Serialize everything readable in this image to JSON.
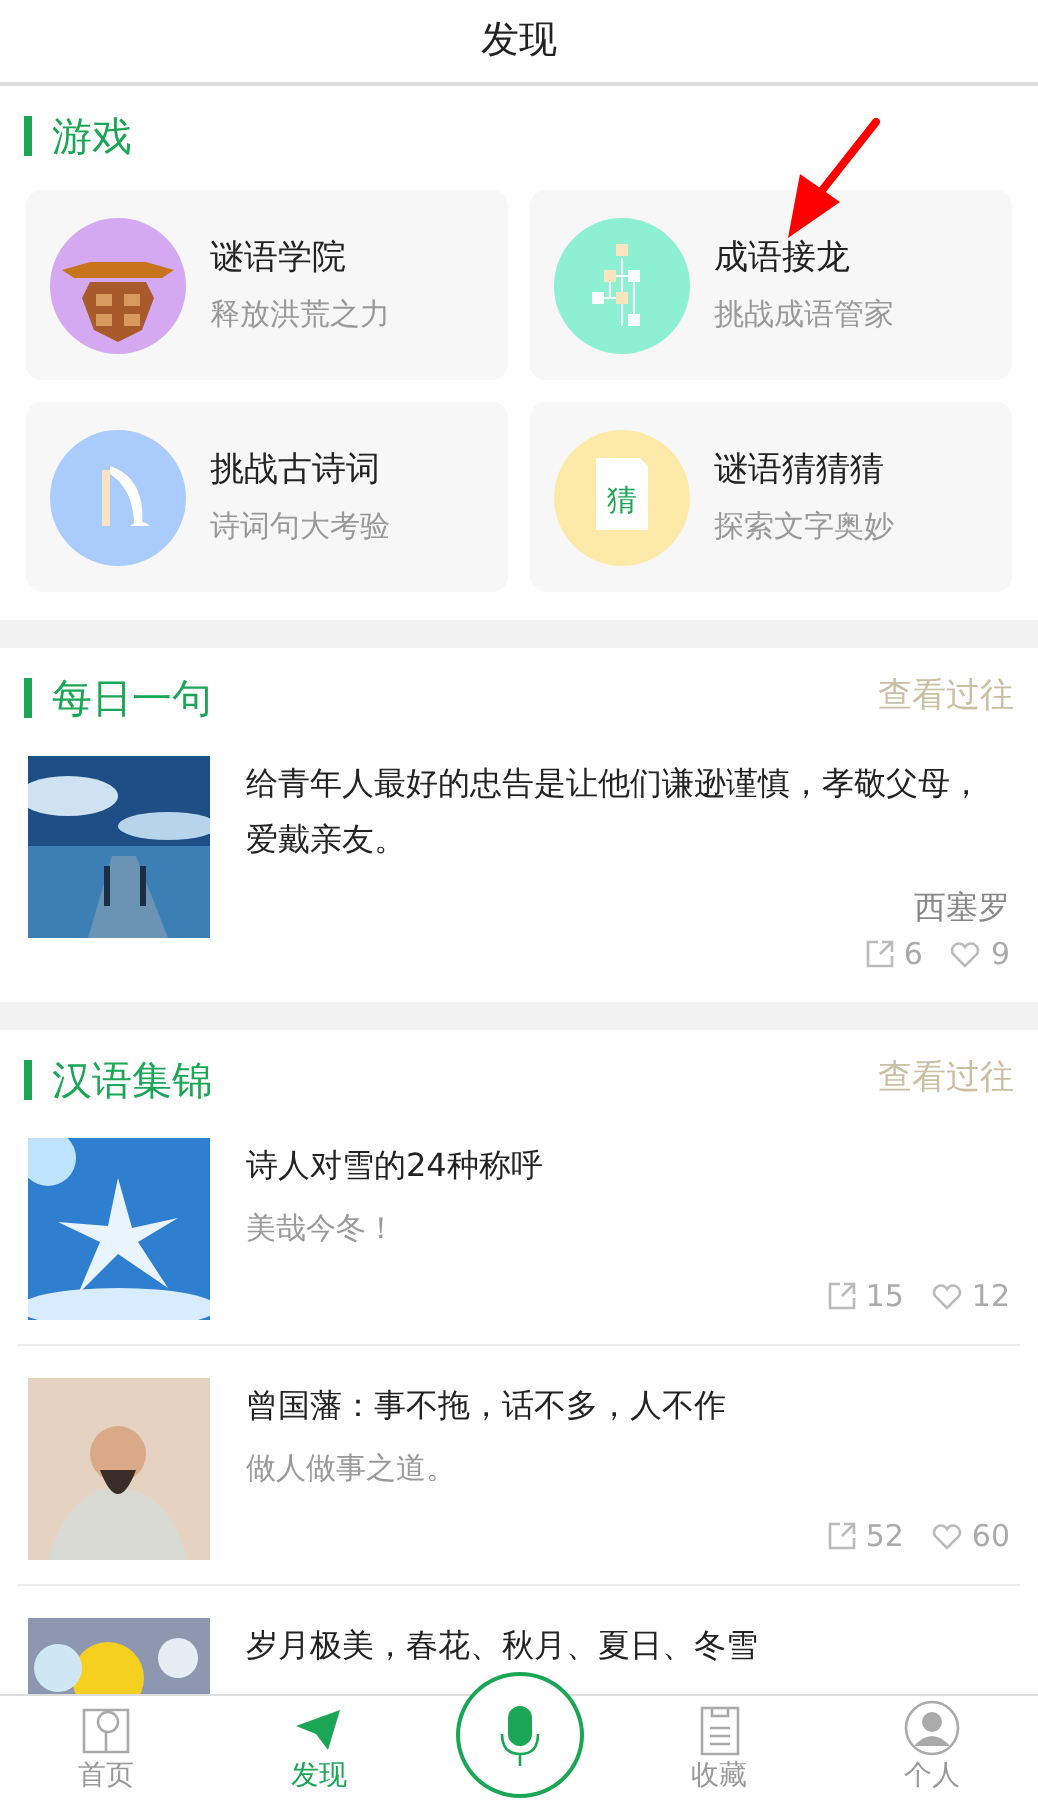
{
  "header": {
    "title": "发现"
  },
  "games": {
    "title": "游戏",
    "items": [
      {
        "kind": "shield",
        "color": "#d4a9f2",
        "title": "谜语学院",
        "subtitle": "释放洪荒之力"
      },
      {
        "kind": "tree",
        "color": "#8ef0d2",
        "title": "成语接龙",
        "subtitle": "挑战成语管家"
      },
      {
        "kind": "quill",
        "color": "#a9ccfc",
        "title": "挑战古诗词",
        "subtitle": "诗词句大考验"
      },
      {
        "kind": "page",
        "color": "#fde9a8",
        "title": "谜语猜猜猜",
        "subtitle": "探索文字奥妙",
        "glyph": "猜"
      }
    ]
  },
  "daily": {
    "title": "每日一句",
    "more": "查看过往",
    "quote": "给青年人最好的忠告是让他们谦逊谨慎，孝敬父母，爱戴亲友。",
    "author": "西塞罗",
    "shares": "6",
    "likes": "9"
  },
  "collection": {
    "title": "汉语集锦",
    "more": "查看过往",
    "items": [
      {
        "title": "诗人对雪的24种称呼",
        "subtitle": "美哉今冬！",
        "shares": "15",
        "likes": "12"
      },
      {
        "title": "曾国藩：事不拖，话不多，人不作",
        "subtitle": "做人做事之道。",
        "shares": "52",
        "likes": "60"
      },
      {
        "title": "岁月极美，春花、秋月、夏日、冬雪"
      }
    ]
  },
  "nav": {
    "items": [
      {
        "kind": "book",
        "label": "首页",
        "selected": false
      },
      {
        "kind": "plane",
        "label": "发现",
        "selected": true
      },
      {
        "kind": "mic",
        "selected": false
      },
      {
        "kind": "notes",
        "label": "收藏",
        "selected": false
      },
      {
        "kind": "person",
        "label": "个人",
        "selected": false
      }
    ]
  }
}
